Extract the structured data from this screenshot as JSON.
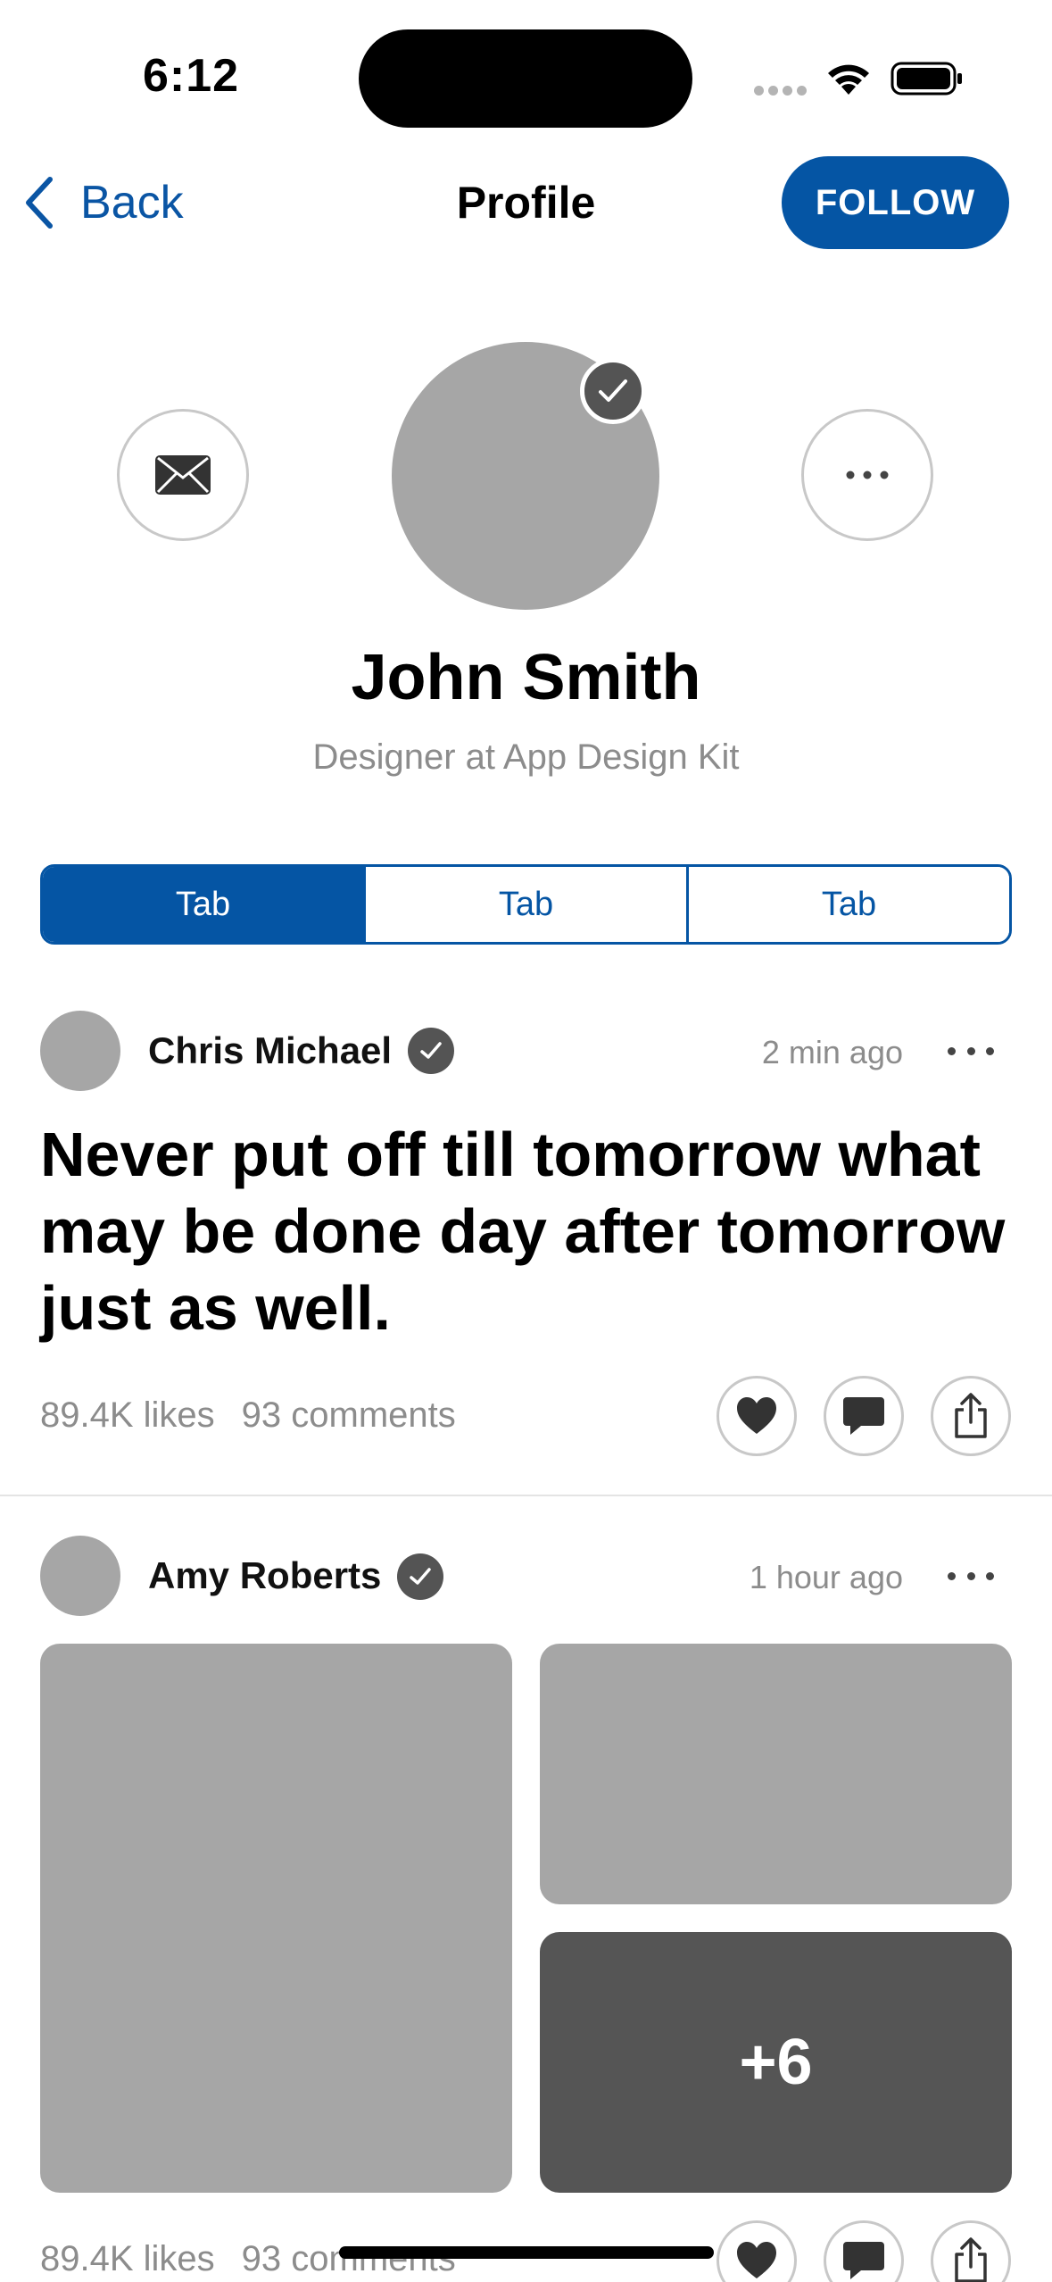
{
  "status_bar": {
    "time": "6:12",
    "icons": [
      "cellular-signal-icon",
      "wifi-icon",
      "battery-icon"
    ]
  },
  "nav": {
    "back_label": "Back",
    "title": "Profile",
    "follow_label": "FOLLOW"
  },
  "profile": {
    "name": "John Smith",
    "subtitle": "Designer at App Design Kit",
    "verified": true
  },
  "tabs": [
    {
      "label": "Tab",
      "active": true
    },
    {
      "label": "Tab",
      "active": false
    },
    {
      "label": "Tab",
      "active": false
    }
  ],
  "posts": [
    {
      "author": "Chris Michael",
      "verified": true,
      "time": "2 min ago",
      "text": "Never put off till tomorrow what may be done day after tomorrow just as well.",
      "likes": "89.4K likes",
      "comments": "93 comments"
    },
    {
      "author": "Amy Roberts",
      "verified": true,
      "time": "1 hour ago",
      "photos_more": "+6",
      "likes": "89.4K likes",
      "comments": "93 comments"
    }
  ],
  "colors": {
    "accent": "#0555a4",
    "placeholder": "#a6a6a6",
    "placeholder_dark": "#555555",
    "secondary_text": "#8c8c8c"
  }
}
